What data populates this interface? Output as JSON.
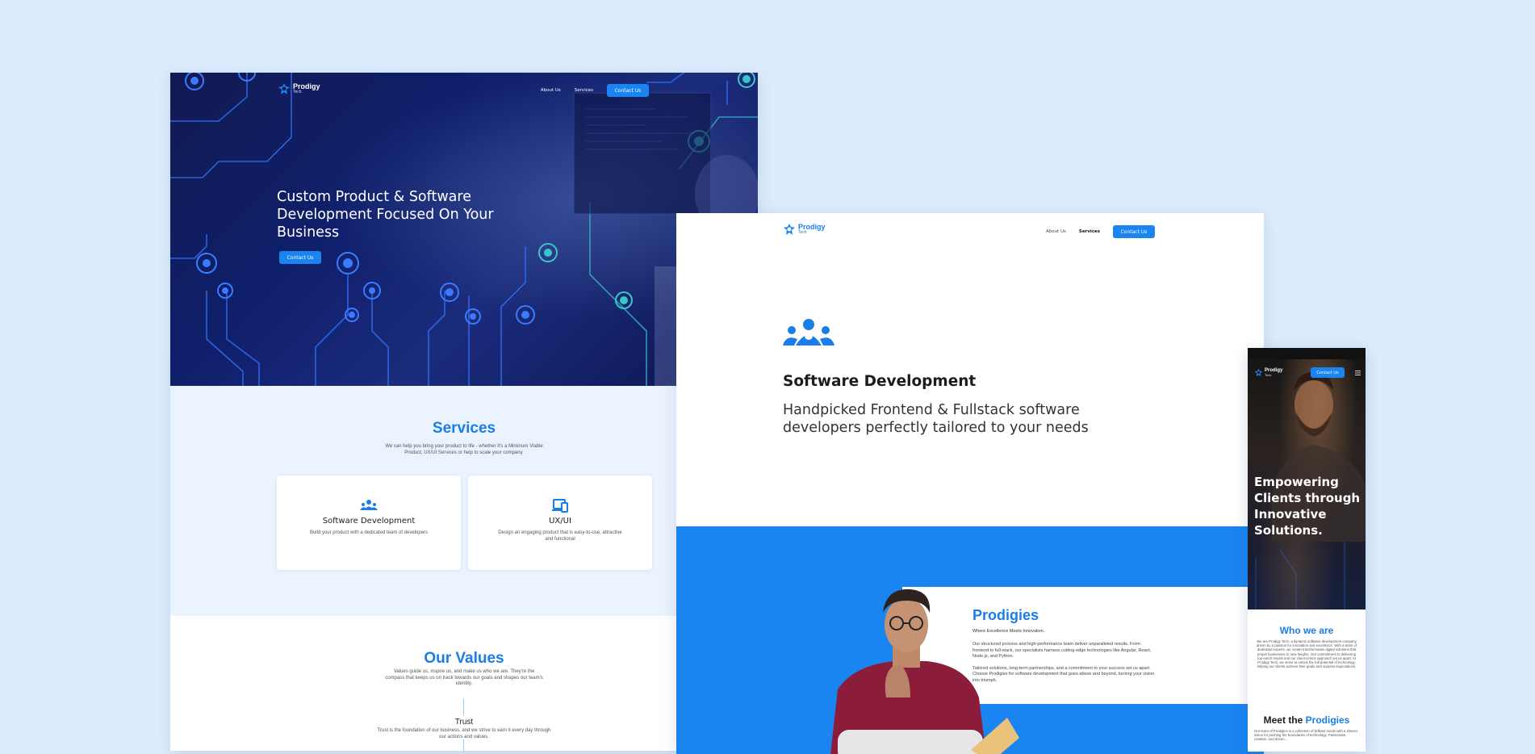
{
  "colors": {
    "background": "#dcecfd",
    "brand": "#1a7de8",
    "button": "#1a84f0",
    "hero_dark": "#121a52"
  },
  "desktop": {
    "logo": {
      "name": "Prodigy",
      "sub": "Tech"
    },
    "nav": {
      "about": "About Us",
      "services": "Services",
      "contact": "Contact Us"
    },
    "hero": {
      "title": "Custom Product & Software Development Focused On Your Business",
      "cta": "Contact Us"
    },
    "services": {
      "title": "Services",
      "description": "We can help you bring your product to life - whether it's a Minimum Viable Product, UX/UI Services or help to scale your company.",
      "cards": [
        {
          "icon": "team-icon",
          "title": "Software Development",
          "desc": "Build your product with a dedicated team of developers"
        },
        {
          "icon": "devices-icon",
          "title": "UX/UI",
          "desc": "Design an engaging product that is easy-to-use, attractive and functional"
        }
      ]
    },
    "values": {
      "title": "Our Values",
      "description": "Values guide us, inspire us, and make us who we are. They're the compass that keeps us on track towards our goals and shapes our team's identity.",
      "first_value": {
        "title": "Trust",
        "desc": "Trust is the foundation of our business, and we strive to earn it every day through our actions and values."
      }
    }
  },
  "service_page": {
    "logo": {
      "name": "Prodigy",
      "sub": "Tech"
    },
    "nav": {
      "about": "About Us",
      "services": "Services",
      "contact": "Contact Us"
    },
    "icon": "team-icon",
    "title": "Software Development",
    "subtitle": "Handpicked Frontend & Fullstack software developers perfectly tailored to your needs",
    "prodigies": {
      "title": "Prodigies",
      "tagline": "Where Excellence Meets Innovation.",
      "paragraph1": "Our structured process and high-performance team deliver unparalleled results. From frontend to full-stack, our specialists harness cutting-edge technologies like Angular, React, Node.js, and Python.",
      "paragraph2": "Tailored solutions, long-term partnerships, and a commitment to your success set us apart. Choose Prodigies for software development that goes above and beyond, turning your vision into triumph."
    }
  },
  "mobile": {
    "logo": {
      "name": "Prodigy",
      "sub": "Tech"
    },
    "contact": "Contact Us",
    "hero_title": "Empowering Clients through Innovative Solutions.",
    "who": {
      "title": "Who we are",
      "body": "We are Prodigy Tech, a dynamic software development company driven by a passion for innovation and excellence. With a team of dedicated experts, we create transformative digital solutions that propel businesses to new heights. Our commitment to delivering top-notch results and our client-centric approach set us apart. At Prodigy Tech, we strive to unlock the full potential of technology, helping our clients achieve their goals and surpass expectations."
    },
    "meet": {
      "title_prefix": "Meet the",
      "title_highlight": "Prodigies",
      "body": "Our team of Prodigies is a collection of brilliant minds with a shared vision for pushing the boundaries of technology. Passionate, creative, and driven..."
    }
  }
}
